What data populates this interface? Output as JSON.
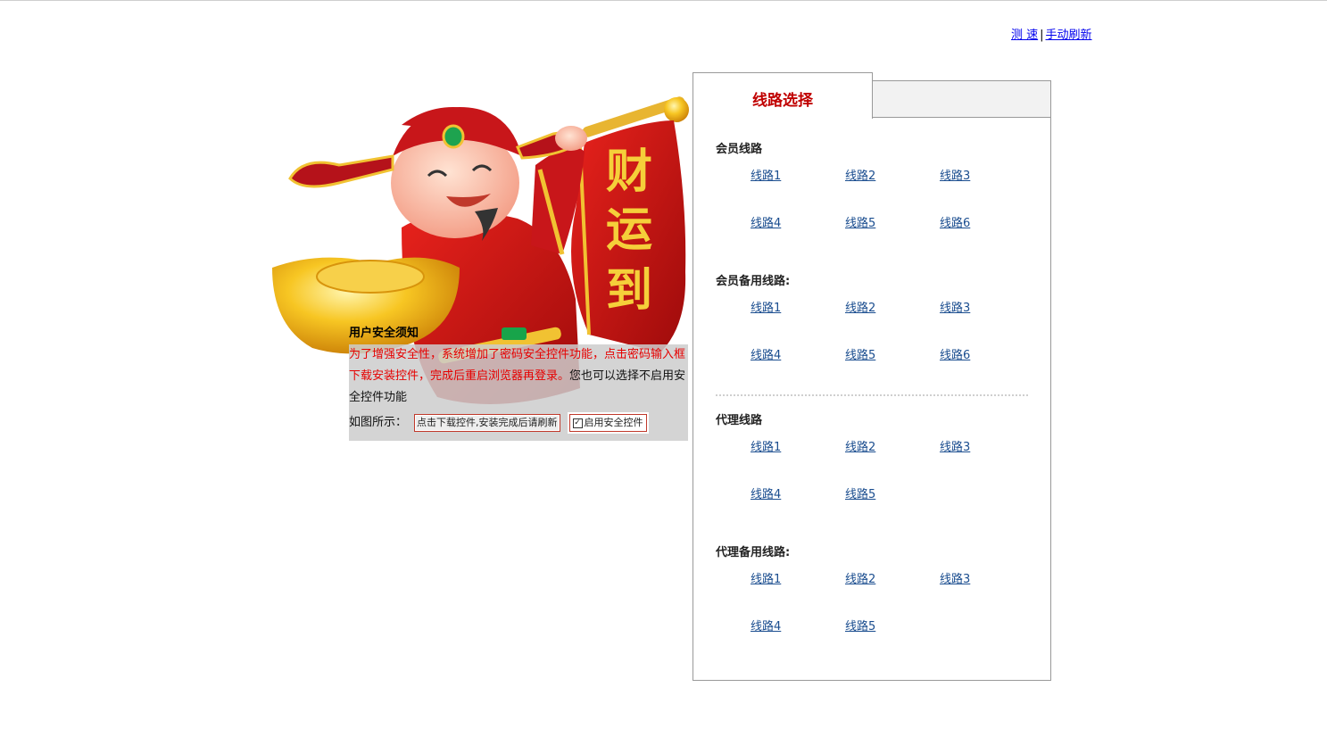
{
  "top_links": {
    "speed_test": "测 速",
    "separator": "|",
    "manual_refresh": "手动刷新"
  },
  "illustration": {
    "banner_text": [
      "财",
      "运",
      "到"
    ]
  },
  "notice": {
    "title": "用户安全须知",
    "red_text": "为了增强安全性，系统增加了密码安全控件功能，点击密码输入框下载安装控件，完成后重启浏览器再登录。",
    "black_text": "您也可以选择不启用安全控件功能",
    "example_label": "如图所示：",
    "download_button": "点击下载控件,安装完成后请刷新",
    "checkbox_mark": "✓",
    "checkbox_label": "启用安全控件"
  },
  "panel": {
    "tab_active": "线路选择",
    "sections": [
      {
        "title": "会员线路",
        "links": [
          "线路1",
          "线路2",
          "线路3",
          "线路4",
          "线路5",
          "线路6"
        ]
      },
      {
        "title": "会员备用线路:",
        "links": [
          "线路1",
          "线路2",
          "线路3",
          "线路4",
          "线路5",
          "线路6"
        ]
      },
      {
        "title": "代理线路",
        "links": [
          "线路1",
          "线路2",
          "线路3",
          "线路4",
          "线路5"
        ]
      },
      {
        "title": "代理备用线路:",
        "links": [
          "线路1",
          "线路2",
          "线路3",
          "线路4",
          "线路5"
        ]
      }
    ]
  },
  "colors": {
    "tab_title": "#c00000",
    "notice_red": "#e60000",
    "link": "#1a4d8f"
  }
}
